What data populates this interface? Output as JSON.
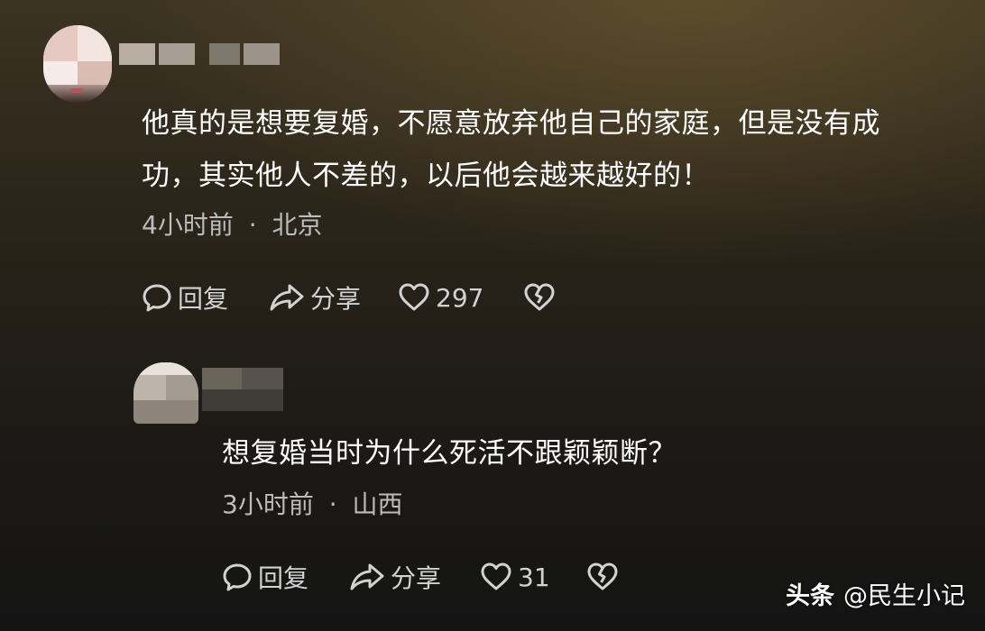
{
  "comments": [
    {
      "text_lines": [
        "他真的是想要复婚，不愿意放弃他自己的家庭，但是没有成",
        "功，其实他人不差的，以后他会越来越好的！"
      ],
      "time": "4小时前",
      "separator": "·",
      "location": "北京",
      "actions": {
        "reply_label": "回复",
        "share_label": "分享",
        "like_count": "297"
      }
    },
    {
      "text_lines": [
        "想复婚当时为什么死活不跟颖颖断？"
      ],
      "time": "3小时前",
      "separator": "·",
      "location": "山西",
      "actions": {
        "reply_label": "回复",
        "share_label": "分享",
        "like_count": "31"
      }
    }
  ],
  "watermark": {
    "brand": "头条",
    "account": "@民生小记"
  },
  "icons": {
    "reply": "speech-bubble-icon",
    "share": "share-arrow-icon",
    "like": "heart-icon",
    "dislike": "broken-heart-icon"
  },
  "colors": {
    "text": "#ffffff",
    "meta": "#bcbcbc",
    "action": "#d2d2d2"
  }
}
